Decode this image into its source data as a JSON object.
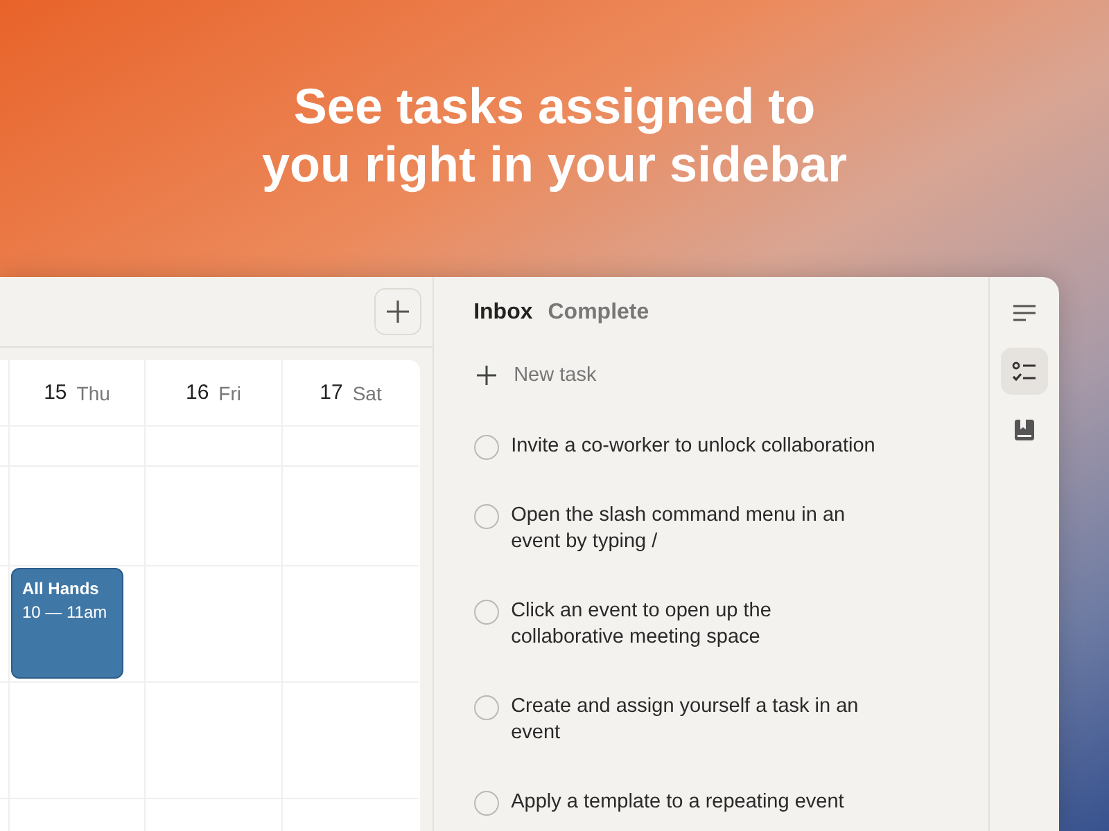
{
  "headline": "See tasks assigned to you right in your sidebar",
  "calendar": {
    "days": [
      {
        "date": "15",
        "weekday": "Thu",
        "events": [
          {
            "title": "All Hands",
            "time": "10 — 11am"
          }
        ]
      },
      {
        "date": "16",
        "weekday": "Fri"
      },
      {
        "date": "17",
        "weekday": "Sat"
      }
    ]
  },
  "tasks_panel": {
    "tabs": [
      {
        "label": "Inbox",
        "selected": true
      },
      {
        "label": "Complete",
        "selected": false
      }
    ],
    "new_task": "New task",
    "tasks": [
      {
        "text": "Invite a co-worker to unlock collaboration",
        "checked": false
      },
      {
        "text": "Open the slash command menu in an event by typing /",
        "checked": false
      },
      {
        "text": "Click an event to open up the collaborative meeting space",
        "checked": false
      },
      {
        "text": "Create and assign yourself a task in an event",
        "checked": false
      },
      {
        "text": "Apply a template to a repeating event",
        "checked": false
      }
    ]
  },
  "sidebar": {
    "items": [
      {
        "kind": "lines",
        "selected": false
      },
      {
        "kind": "checklist",
        "selected": true
      },
      {
        "kind": "book",
        "selected": false
      }
    ]
  }
}
